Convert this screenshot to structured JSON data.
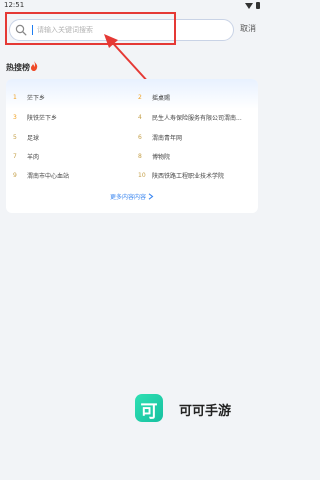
{
  "status_bar": {
    "time": "12:51"
  },
  "search": {
    "placeholder": "请输入关键词搜索",
    "value": "",
    "cancel_label": "取消"
  },
  "hot_list": {
    "title": "热搜榜",
    "items": [
      {
        "rank": "1",
        "label": "茫下乡"
      },
      {
        "rank": "2",
        "label": "摇桌赐"
      },
      {
        "rank": "3",
        "label": "陕铁茫下乡"
      },
      {
        "rank": "4",
        "label": "民生人寿保险服务有限公司渭南..."
      },
      {
        "rank": "5",
        "label": "足球"
      },
      {
        "rank": "6",
        "label": "渭南青年网"
      },
      {
        "rank": "7",
        "label": "羊肉"
      },
      {
        "rank": "8",
        "label": "博物院"
      },
      {
        "rank": "9",
        "label": "渭南市中心血站"
      },
      {
        "rank": "10",
        "label": "陕西铁路工程职业技术学院"
      }
    ],
    "more_label": "更多内容内容"
  },
  "watermark": {
    "logo_char": "可",
    "text": "可可手游"
  },
  "colors": {
    "accent": "#1e7df1",
    "highlight": "#e53935",
    "rank": "#c5a04a",
    "logo": "#2fe0b3"
  }
}
